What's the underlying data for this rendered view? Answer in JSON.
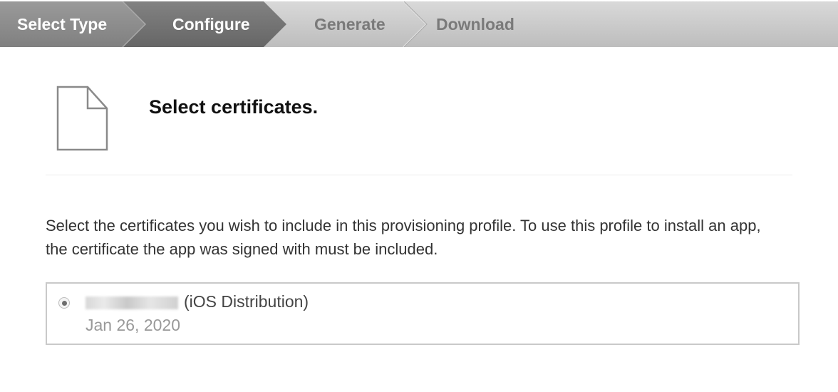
{
  "steps": [
    {
      "label": "Select Type",
      "state": "done"
    },
    {
      "label": "Configure",
      "state": "active"
    },
    {
      "label": "Generate",
      "state": "pending"
    },
    {
      "label": "Download",
      "state": "pending"
    }
  ],
  "icon": "document-icon",
  "heading": "Select certificates.",
  "description": "Select the certificates you wish to include in this provisioning profile. To use this profile to install an app, the certificate the app was signed with must be included.",
  "certificates": [
    {
      "name_redacted": true,
      "type": "(iOS Distribution)",
      "date": "Jan 26, 2020",
      "selected": true
    }
  ],
  "colors": {
    "step_done": "#8c8c8c",
    "step_active": "#6f6f6f",
    "step_pending": "#c9c9c9",
    "box_border": "#c9c9c9"
  }
}
